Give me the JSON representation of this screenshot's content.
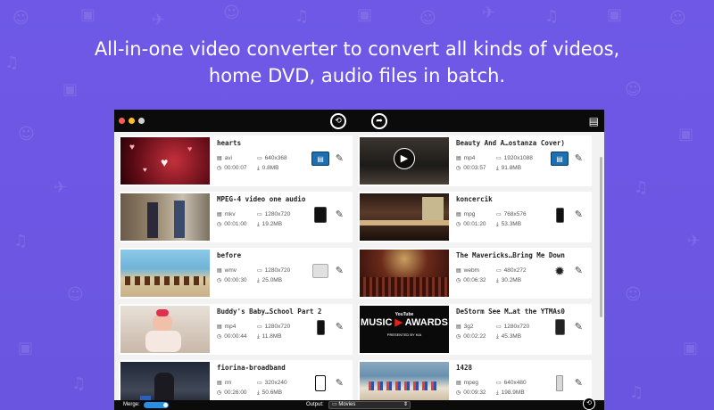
{
  "headline": {
    "line1": "All-in-one video converter to convert all kinds of videos,",
    "line2": "home DVD, audio files in batch."
  },
  "window": {
    "traffic_lights": [
      "#fc5c54",
      "#fdbc2e",
      "#d0d0d0"
    ],
    "toolbar_icons": [
      "convert-icon",
      "share-icon",
      "media-browser-icon"
    ]
  },
  "files": [
    {
      "title": "hearts",
      "format": "avi",
      "resolution": "640x368",
      "duration": "00:00:07",
      "size": "0.8MB",
      "device": "video-format-icon",
      "thumb": "hearts"
    },
    {
      "title": "Beauty And A…ostanza Cover)",
      "format": "mp4",
      "resolution": "1920x1088",
      "duration": "00:03:57",
      "size": "91.8MB",
      "device": "video-format-icon",
      "thumb": "concert-play"
    },
    {
      "title": "MPEG-4 video one audio",
      "format": "mkv",
      "resolution": "1280x720",
      "duration": "00:01:00",
      "size": "19.2MB",
      "device": "ipad-icon",
      "thumb": "office"
    },
    {
      "title": "koncercik",
      "format": "mpg",
      "resolution": "768x576",
      "duration": "00:01:20",
      "size": "53.3MB",
      "device": "iphone-icon",
      "thumb": "stage"
    },
    {
      "title": "before",
      "format": "wmv",
      "resolution": "1280x720",
      "duration": "00:00:30",
      "size": "25.0MB",
      "device": "media-player-icon",
      "thumb": "beach"
    },
    {
      "title": "The Mavericks…Bring Me Down",
      "format": "webm",
      "resolution": "480x272",
      "duration": "00:06:32",
      "size": "30.2MB",
      "device": "reel-icon",
      "thumb": "crowd"
    },
    {
      "title": "Buddy's Baby…School Part 2",
      "format": "mp4",
      "resolution": "1280x720",
      "duration": "00:00:44",
      "size": "11.8MB",
      "device": "iphone-icon",
      "thumb": "baby"
    },
    {
      "title": "DeStorm See M…at the YTMAs0",
      "format": "3g2",
      "resolution": "1280x720",
      "duration": "00:02:22",
      "size": "45.3MB",
      "device": "phone-icon",
      "thumb": "awards"
    },
    {
      "title": "fiorina-broadband",
      "format": "rm",
      "resolution": "320x240",
      "duration": "00:26:00",
      "size": "50.6MB",
      "device": "tablet-icon",
      "thumb": "speech"
    },
    {
      "title": "1428",
      "format": "mpeg",
      "resolution": "640x480",
      "duration": "00:09:32",
      "size": "198.9MB",
      "device": "ipod-icon",
      "thumb": "pool"
    }
  ],
  "awards_thumb": {
    "line1": "YouTube",
    "line2": "MUSIC",
    "line3": "AWARDS",
    "line4": "PRESENTED BY KIA"
  },
  "bottom": {
    "merge_label": "Merge:",
    "output_label": "Output:",
    "output_value": "Movies"
  }
}
